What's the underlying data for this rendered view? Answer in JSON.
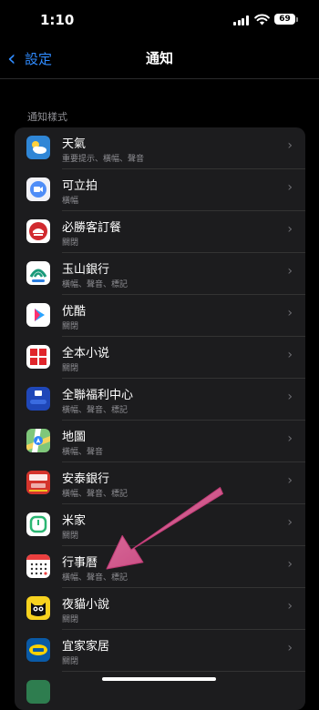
{
  "status_bar": {
    "time": "1:10",
    "battery": "69"
  },
  "nav": {
    "back_label": "設定",
    "title": "通知"
  },
  "section_header": "通知樣式",
  "apps": [
    {
      "name": "天氣",
      "sub": "重要提示、橫幅、聲音",
      "icon": "weather-icon"
    },
    {
      "name": "可立拍",
      "sub": "橫幅",
      "icon": "clips-icon"
    },
    {
      "name": "必勝客訂餐",
      "sub": "關閉",
      "icon": "pizza-hut-icon"
    },
    {
      "name": "玉山銀行",
      "sub": "橫幅、聲音、標記",
      "icon": "esun-bank-icon"
    },
    {
      "name": "优酷",
      "sub": "關閉",
      "icon": "youku-icon"
    },
    {
      "name": "全本小说",
      "sub": "關閉",
      "icon": "quanben-novel-icon"
    },
    {
      "name": "全聯福利中心",
      "sub": "橫幅、聲音、標記",
      "icon": "pxpay-icon"
    },
    {
      "name": "地圖",
      "sub": "橫幅、聲音",
      "icon": "maps-icon"
    },
    {
      "name": "安泰銀行",
      "sub": "橫幅、聲音、標記",
      "icon": "entie-bank-icon"
    },
    {
      "name": "米家",
      "sub": "關閉",
      "icon": "mijia-icon"
    },
    {
      "name": "行事曆",
      "sub": "橫幅、聲音、標記",
      "icon": "calendar-icon"
    },
    {
      "name": "夜貓小說",
      "sub": "關閉",
      "icon": "night-owl-novel-icon"
    },
    {
      "name": "宜家家居",
      "sub": "關閉",
      "icon": "ikea-icon"
    }
  ]
}
